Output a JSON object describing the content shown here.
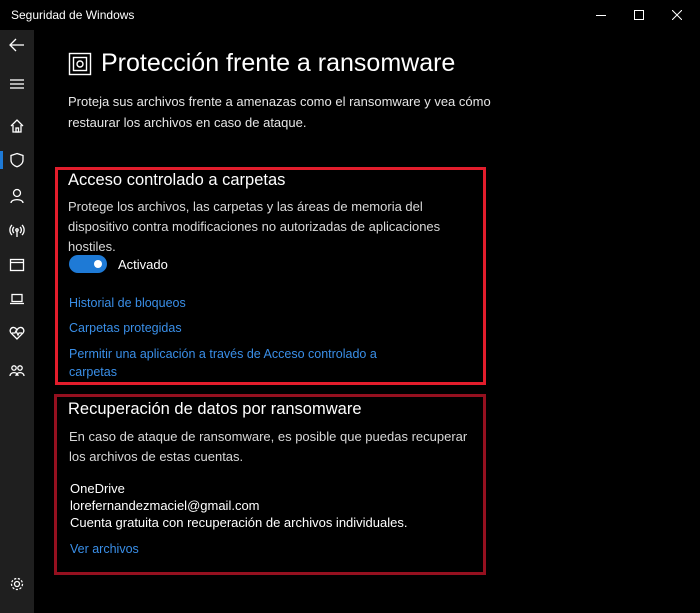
{
  "window": {
    "title": "Seguridad de Windows"
  },
  "sidebar": {
    "items": [
      {
        "name": "back-icon"
      },
      {
        "name": "hamburger-menu-icon"
      },
      {
        "name": "home-icon"
      },
      {
        "name": "shield-icon",
        "active": true
      },
      {
        "name": "person-icon"
      },
      {
        "name": "network-icon"
      },
      {
        "name": "app-browser-icon"
      },
      {
        "name": "device-laptop-icon"
      },
      {
        "name": "heart-health-icon"
      },
      {
        "name": "family-icon"
      },
      {
        "name": "settings-gear-icon"
      }
    ]
  },
  "header": {
    "title": "Protección frente a ransomware",
    "description": "Proteja sus archivos frente a amenazas como el ransomware y vea cómo restaurar los archivos en caso de ataque."
  },
  "controlled_access": {
    "title": "Acceso controlado a carpetas",
    "description": "Protege los archivos, las carpetas y las áreas de memoria del dispositivo contra modificaciones no autorizadas de aplicaciones hostiles.",
    "toggle_label": "Activado",
    "toggle_on": true,
    "links": {
      "history": "Historial de bloqueos",
      "protected": "Carpetas protegidas",
      "allow_app": "Permitir una aplicación a través de Acceso controlado a carpetas"
    }
  },
  "recovery": {
    "title": "Recuperación de datos por ransomware",
    "description": "En caso de ataque de ransomware, es posible que puedas recuperar los archivos de estas cuentas.",
    "provider": "OneDrive",
    "email": "lorefernandezmaciel@gmail.com",
    "account_type": "Cuenta gratuita con recuperación de archivos individuales.",
    "view_files_link": "Ver archivos"
  },
  "colors": {
    "accent": "#1e7ad6",
    "link": "#3a8fe8",
    "highlight_red": "#e21d2c",
    "highlight_dark_red": "#95101f"
  }
}
